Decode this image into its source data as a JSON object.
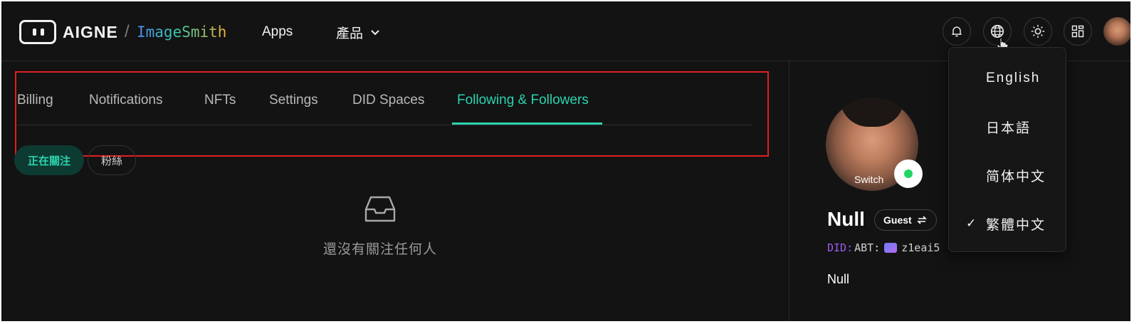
{
  "brand": {
    "name": "AIGNE",
    "separator": "/",
    "app": "ImageSmith"
  },
  "nav": {
    "apps": "Apps",
    "product": "產品"
  },
  "header_icons": [
    "bell-icon",
    "globe-icon",
    "sun-icon",
    "apps-grid-icon",
    "user-avatar"
  ],
  "tabs": [
    {
      "label": "Billing",
      "active": false
    },
    {
      "label": "Notifications",
      "active": false
    },
    {
      "label": "NFTs",
      "active": false
    },
    {
      "label": "Settings",
      "active": false
    },
    {
      "label": "DID Spaces",
      "active": false
    },
    {
      "label": "Following & Followers",
      "active": true
    }
  ],
  "subtabs": {
    "following": "正在關注",
    "followers": "粉絲"
  },
  "empty_state": {
    "icon": "inbox-icon",
    "text": "還沒有關注任何人"
  },
  "profile": {
    "switch_label": "Switch",
    "name": "Null",
    "role_badge": "Guest",
    "did_prefix": "DID:",
    "did_type": "ABT:",
    "did_value": "z1eai5",
    "description": "Null"
  },
  "language_menu": {
    "items": [
      {
        "label": "English",
        "selected": false
      },
      {
        "label": "日本語",
        "selected": false
      },
      {
        "label": "简体中文",
        "selected": false
      },
      {
        "label": "繁體中文",
        "selected": true
      }
    ],
    "check_mark": "✓"
  },
  "colors": {
    "background": "#131313",
    "accent": "#2bd4b0",
    "highlight_box": "#e02020",
    "did_prefix": "#9b5cf0",
    "online": "#1ed760"
  }
}
